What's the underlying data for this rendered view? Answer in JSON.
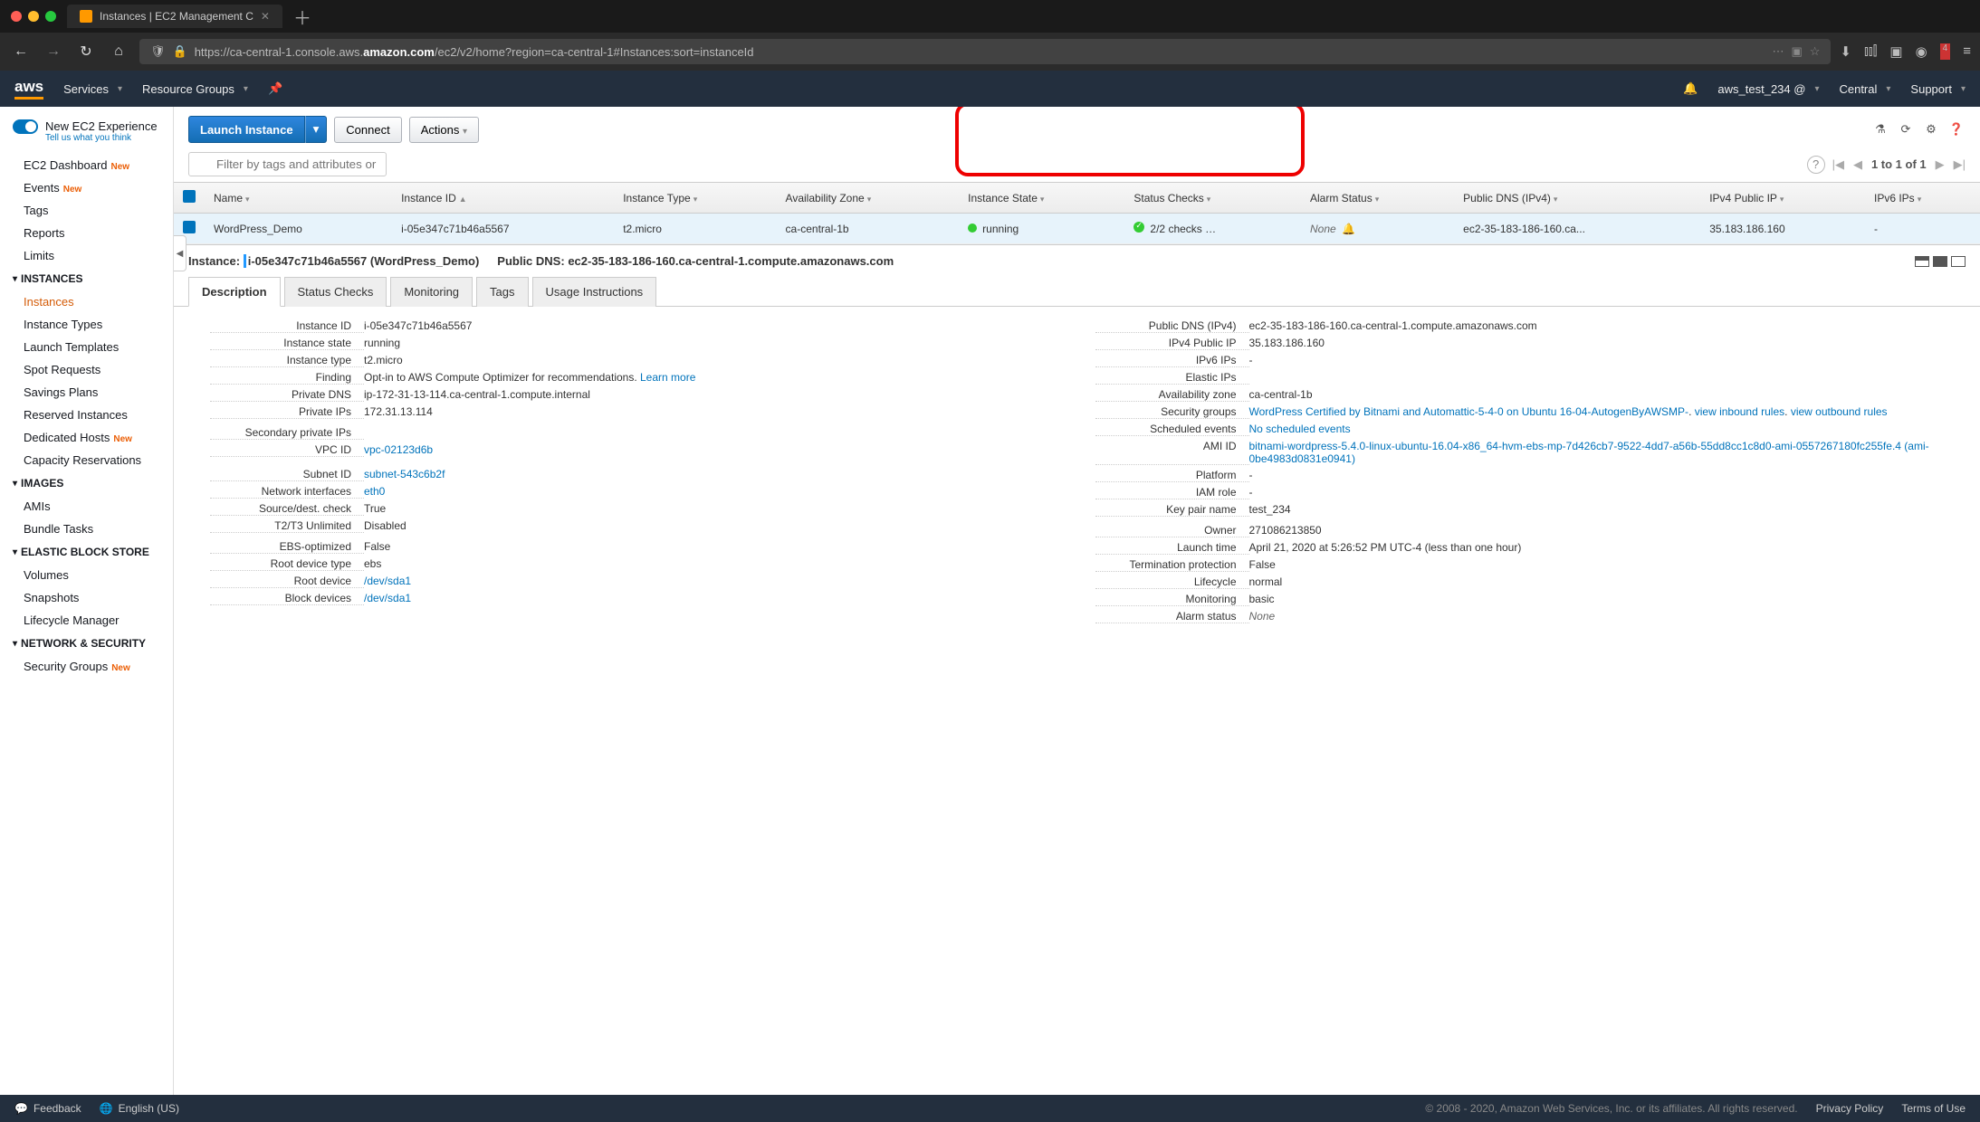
{
  "browser": {
    "tab_title": "Instances | EC2 Management C",
    "url_prefix": "https://ca-central-1.console.aws.",
    "url_bold": "amazon.com",
    "url_suffix": "/ec2/v2/home?region=ca-central-1#Instances:sort=instanceId"
  },
  "header": {
    "logo": "aws",
    "services": "Services",
    "resource_groups": "Resource Groups",
    "account": "aws_test_234 @",
    "region": "Central",
    "support": "Support"
  },
  "sidebar": {
    "new_exp": "New EC2 Experience",
    "new_exp_sub": "Tell us what you think",
    "items_top": [
      "EC2 Dashboard",
      "Events",
      "Tags",
      "Reports",
      "Limits"
    ],
    "new_badges": {
      "EC2 Dashboard": true,
      "Events": true,
      "Dedicated Hosts": true,
      "Security Groups": true
    },
    "sect_instances": "INSTANCES",
    "instances_items": [
      "Instances",
      "Instance Types",
      "Launch Templates",
      "Spot Requests",
      "Savings Plans",
      "Reserved Instances",
      "Dedicated Hosts",
      "Capacity Reservations"
    ],
    "sect_images": "IMAGES",
    "images_items": [
      "AMIs",
      "Bundle Tasks"
    ],
    "sect_ebs": "ELASTIC BLOCK STORE",
    "ebs_items": [
      "Volumes",
      "Snapshots",
      "Lifecycle Manager"
    ],
    "sect_net": "NETWORK & SECURITY",
    "net_items": [
      "Security Groups"
    ]
  },
  "actions": {
    "launch": "Launch Instance",
    "connect": "Connect",
    "actions": "Actions"
  },
  "filter": {
    "placeholder": "Filter by tags and attributes or search by keyword",
    "pager": "1 to 1 of 1"
  },
  "columns": [
    "",
    "Name",
    "Instance ID",
    "Instance Type",
    "Availability Zone",
    "Instance State",
    "Status Checks",
    "Alarm Status",
    "Public DNS (IPv4)",
    "IPv4 Public IP",
    "IPv6 IPs"
  ],
  "row": {
    "name": "WordPress_Demo",
    "instance_id": "i-05e347c71b46a5567",
    "instance_type": "t2.micro",
    "az": "ca-central-1b",
    "state": "running",
    "checks": "2/2 checks …",
    "alarm": "None",
    "dns": "ec2-35-183-186-160.ca...",
    "ip": "35.183.186.160",
    "ipv6": "-"
  },
  "detail_header": {
    "label_instance": "Instance:",
    "instance": "i-05e347c71b46a5567 (WordPress_Demo)",
    "label_dns": "Public DNS:",
    "dns": "ec2-35-183-186-160.ca-central-1.compute.amazonaws.com"
  },
  "tabs": [
    "Description",
    "Status Checks",
    "Monitoring",
    "Tags",
    "Usage Instructions"
  ],
  "desc_left": [
    {
      "k": "Instance ID",
      "v": "i-05e347c71b46a5567"
    },
    {
      "k": "Instance state",
      "v": "running"
    },
    {
      "k": "Instance type",
      "v": "t2.micro"
    },
    {
      "k": "Finding",
      "v": "Opt-in to AWS Compute Optimizer for recommendations. ",
      "link": "Learn more"
    },
    {
      "k": "Private DNS",
      "v": "ip-172-31-13-114.ca-central-1.compute.internal"
    },
    {
      "k": "Private IPs",
      "v": "172.31.13.114"
    },
    {
      "k": "",
      "v": ""
    },
    {
      "k": "Secondary private IPs",
      "v": ""
    },
    {
      "k": "VPC ID",
      "link": "vpc-02123d6b"
    },
    {
      "k": "",
      "v": ""
    },
    {
      "k": "",
      "v": ""
    },
    {
      "k": "Subnet ID",
      "link": "subnet-543c6b2f"
    },
    {
      "k": "Network interfaces",
      "link": "eth0"
    },
    {
      "k": "Source/dest. check",
      "v": "True"
    },
    {
      "k": "T2/T3 Unlimited",
      "v": "Disabled"
    },
    {
      "k": "",
      "v": ""
    },
    {
      "k": "EBS-optimized",
      "v": "False"
    },
    {
      "k": "Root device type",
      "v": "ebs"
    },
    {
      "k": "Root device",
      "link": "/dev/sda1"
    },
    {
      "k": "Block devices",
      "link": "/dev/sda1"
    }
  ],
  "desc_right": [
    {
      "k": "Public DNS (IPv4)",
      "v": "ec2-35-183-186-160.ca-central-1.compute.amazonaws.com"
    },
    {
      "k": "IPv4 Public IP",
      "v": "35.183.186.160"
    },
    {
      "k": "IPv6 IPs",
      "v": "-"
    },
    {
      "k": "Elastic IPs",
      "v": ""
    },
    {
      "k": "Availability zone",
      "v": "ca-central-1b"
    },
    {
      "k": "Security groups",
      "links": [
        "WordPress Certified by Bitnami and Automattic-5-4-0 on Ubuntu 16-04-AutogenByAWSMP-",
        ". ",
        "view inbound rules",
        ". ",
        "view outbound rules"
      ]
    },
    {
      "k": "Scheduled events",
      "link": "No scheduled events"
    },
    {
      "k": "AMI ID",
      "links": [
        "bitnami-wordpress-5.4.0-linux-ubuntu-16.04-x86_64-hvm-ebs-mp-7d426cb7-9522-4dd7-a56b-55dd8cc1c8d0-ami-0557267180fc255fe.4 (ami-0be4983d0831e0941)"
      ]
    },
    {
      "k": "Platform",
      "v": "-"
    },
    {
      "k": "IAM role",
      "v": "-"
    },
    {
      "k": "Key pair name",
      "v": "test_234"
    },
    {
      "k": "",
      "v": ""
    },
    {
      "k": "Owner",
      "v": "271086213850"
    },
    {
      "k": "Launch time",
      "v": "April 21, 2020 at 5:26:52 PM UTC-4 (less than one hour)"
    },
    {
      "k": "Termination protection",
      "v": "False"
    },
    {
      "k": "Lifecycle",
      "v": "normal"
    },
    {
      "k": "Monitoring",
      "v": "basic"
    },
    {
      "k": "Alarm status",
      "v": "None",
      "italic": true
    }
  ],
  "footer": {
    "feedback": "Feedback",
    "lang": "English (US)",
    "copyright": "© 2008 - 2020, Amazon Web Services, Inc. or its affiliates. All rights reserved.",
    "privacy": "Privacy Policy",
    "terms": "Terms of Use"
  }
}
